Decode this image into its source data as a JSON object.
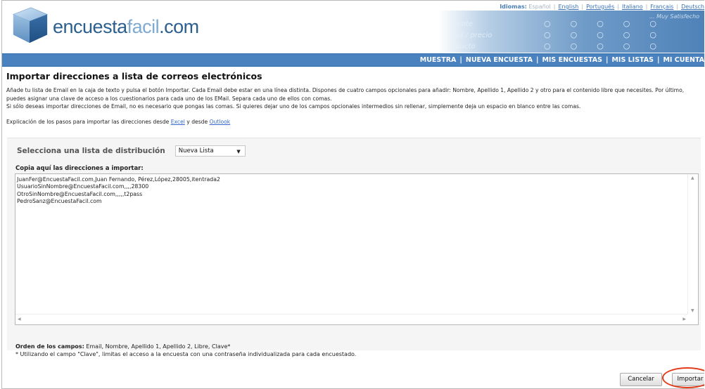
{
  "brand": {
    "logo_main": "encuesta",
    "logo_thin": "facil",
    "logo_suffix": ".com"
  },
  "languages": {
    "label": "Idiomas:",
    "current": "Español",
    "options": [
      "English",
      "Português",
      "Italiano",
      "Français",
      "Deutsch"
    ]
  },
  "banner": {
    "rows": [
      "Cliente",
      "idad / precio",
      "roducto"
    ],
    "tagline": "... Muy Satisfecho"
  },
  "nav": [
    "MUESTRA",
    "NUEVA ENCUESTA",
    "MIS ENCUESTAS",
    "MIS LISTAS",
    "MI CUENTA"
  ],
  "page": {
    "title": "Importar direcciones a lista de correos electrónicos",
    "description_1": "Añade tu lista de Email en la caja de texto y pulsa el botón Importar. Cada Email debe estar en una línea distinta. Dispones de cuatro campos opcionales para añadir: Nombre, Apellido 1, Apellido 2 y otro para el contenido libre que necesites. Por último, puedes asignar una clave de acceso a los cuestionarios para cada uno de los EMail. Separa cada uno de ellos con comas.",
    "description_2": "Si sólo deseas importar direcciones de Email, no es necesario que pongas las comas. Si quieres dejar uno de los campos opcionales intermedios sin rellenar, simplemente deja un espacio en blanco entre las comas.",
    "steps_text": "Explicación de los pasos para importar las direcciones desde",
    "steps_link_excel": "Excel",
    "steps_and": "y desde",
    "steps_link_outlook": "Outlook"
  },
  "form": {
    "select_label": "Selecciona una lista de distribución",
    "select_value": "Nueva Lista",
    "copy_label": "Copia aquí las direcciones a importar:",
    "textarea_value": "JuanFer@EncuestaFacil.com,Juan Fernando, Pérez,López,28005,itentrada2\nUsuarioSinNombre@EncuestaFacil.com,,,,28300\nOtroSinNombre@EncuestaFacil.com,,,,,t2pass\nPedroSanz@EncuestaFacil.com",
    "order_label": "Orden de los campos:",
    "order_value": "Email, Nombre, Apellido 1, Apellido 2, Libre, Clave*",
    "order_note": "* Utilizando el campo \"Clave\", limitas el acceso a la encuesta con una contraseña individualizada para cada encuestado."
  },
  "buttons": {
    "cancel": "Cancelar",
    "import": "Importar"
  },
  "colors": {
    "nav_bg": "#4a82bf",
    "brand_blue": "#2a5f8f",
    "link": "#3366cc",
    "highlight": "#e23b1a"
  }
}
